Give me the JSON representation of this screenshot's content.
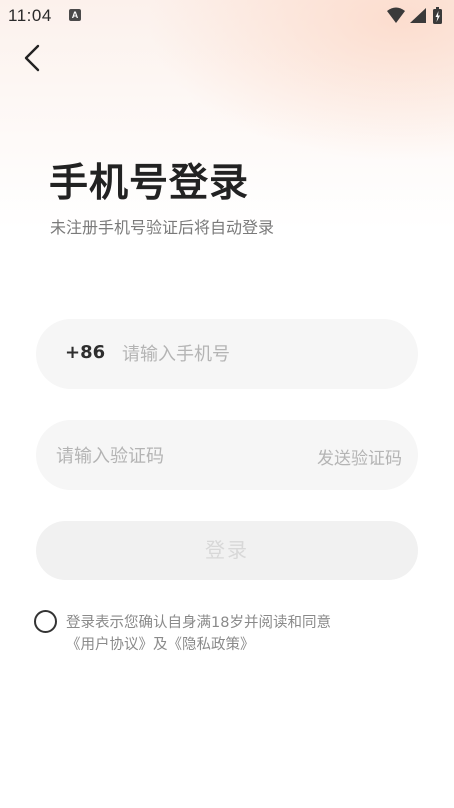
{
  "status_bar": {
    "time": "11:04",
    "notification_icon": "a-notification-icon",
    "icons": [
      "wifi-icon",
      "signal-icon",
      "battery-charging-icon"
    ]
  },
  "header": {
    "back_icon": "chevron-left-icon"
  },
  "login": {
    "title": "手机号登录",
    "subtitle": "未注册手机号验证后将自动登录",
    "country_code": "+86",
    "phone_placeholder": "请输入手机号",
    "phone_value": "",
    "code_placeholder": "请输入验证码",
    "code_value": "",
    "send_code_label": "发送验证码",
    "login_button_label": "登录"
  },
  "agreement": {
    "checked": false,
    "prefix": "登录表示您确认自身满18岁并阅读和同意",
    "user_agreement": "《用户协议》",
    "conjunction": "及",
    "privacy_policy": "《隐私政策》"
  },
  "colors": {
    "field_bg": "#f6f6f6",
    "button_disabled_bg": "#f1f1f1",
    "button_disabled_text": "#d8d8d8",
    "title": "#222222",
    "placeholder": "#b4b4b4"
  }
}
